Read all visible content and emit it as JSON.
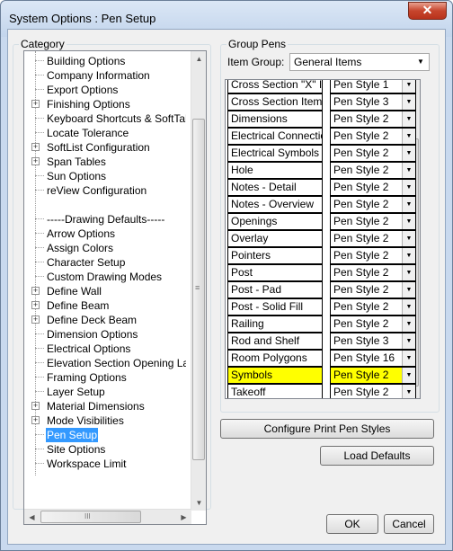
{
  "window": {
    "title": "System Options : Pen Setup",
    "close_glyph": "✕"
  },
  "category": {
    "title": "Category",
    "items": [
      {
        "label": "Building Options",
        "expandable": false
      },
      {
        "label": "Company Information",
        "expandable": false
      },
      {
        "label": "Export Options",
        "expandable": false
      },
      {
        "label": "Finishing Options",
        "expandable": true
      },
      {
        "label": "Keyboard Shortcuts & SoftTalk C",
        "expandable": false
      },
      {
        "label": "Locate Tolerance",
        "expandable": false
      },
      {
        "label": "SoftList Configuration",
        "expandable": true
      },
      {
        "label": "Span Tables",
        "expandable": true
      },
      {
        "label": "Sun Options",
        "expandable": false
      },
      {
        "label": "reView Configuration",
        "expandable": false
      },
      {
        "label": "",
        "expandable": false
      },
      {
        "label": "-----Drawing Defaults-----",
        "expandable": false
      },
      {
        "label": "Arrow Options",
        "expandable": false
      },
      {
        "label": "Assign Colors",
        "expandable": false
      },
      {
        "label": "Character Setup",
        "expandable": false
      },
      {
        "label": "Custom Drawing Modes",
        "expandable": false
      },
      {
        "label": "Define Wall",
        "expandable": true
      },
      {
        "label": "Define Beam",
        "expandable": true
      },
      {
        "label": "Define Deck Beam",
        "expandable": true
      },
      {
        "label": "Dimension Options",
        "expandable": false
      },
      {
        "label": "Electrical Options",
        "expandable": false
      },
      {
        "label": "Elevation Section Opening Labe",
        "expandable": false
      },
      {
        "label": "Framing Options",
        "expandable": false
      },
      {
        "label": "Layer Setup",
        "expandable": false
      },
      {
        "label": "Material Dimensions",
        "expandable": true
      },
      {
        "label": "Mode Visibilities",
        "expandable": true
      },
      {
        "label": "Pen Setup",
        "expandable": false,
        "selected": true
      },
      {
        "label": "Site Options",
        "expandable": false
      },
      {
        "label": "Workspace Limit",
        "expandable": false
      }
    ],
    "scroll_grip": "≡",
    "hscroll_grip": "III"
  },
  "group_pens": {
    "title": "Group Pens",
    "item_group_label": "Item Group:",
    "item_group_value": "General Items",
    "rows": [
      {
        "name": "Cross Section \"X\" Iter",
        "pen": "Pen Style 1"
      },
      {
        "name": "Cross Section Items",
        "pen": "Pen Style 3"
      },
      {
        "name": "Dimensions",
        "pen": "Pen Style 2"
      },
      {
        "name": "Electrical Connection",
        "pen": "Pen Style 2"
      },
      {
        "name": "Electrical Symbols",
        "pen": "Pen Style 2"
      },
      {
        "name": "Hole",
        "pen": "Pen Style 2"
      },
      {
        "name": "Notes - Detail",
        "pen": "Pen Style 2"
      },
      {
        "name": "Notes - Overview",
        "pen": "Pen Style 2"
      },
      {
        "name": "Openings",
        "pen": "Pen Style 2"
      },
      {
        "name": "Overlay",
        "pen": "Pen Style 2"
      },
      {
        "name": "Pointers",
        "pen": "Pen Style 2"
      },
      {
        "name": "Post",
        "pen": "Pen Style 2"
      },
      {
        "name": "Post - Pad",
        "pen": "Pen Style 2"
      },
      {
        "name": "Post - Solid Fill",
        "pen": "Pen Style 2"
      },
      {
        "name": "Railing",
        "pen": "Pen Style 2"
      },
      {
        "name": "Rod and Shelf",
        "pen": "Pen Style 3"
      },
      {
        "name": "Room Polygons",
        "pen": "Pen Style 16"
      },
      {
        "name": "Symbols",
        "pen": "Pen Style 2",
        "highlighted": true
      },
      {
        "name": "Takeoff",
        "pen": "Pen Style 2"
      }
    ],
    "highlight_color": "#ffff00"
  },
  "buttons": {
    "configure": "Configure Print Pen Styles",
    "load_defaults": "Load Defaults",
    "ok": "OK",
    "cancel": "Cancel"
  }
}
